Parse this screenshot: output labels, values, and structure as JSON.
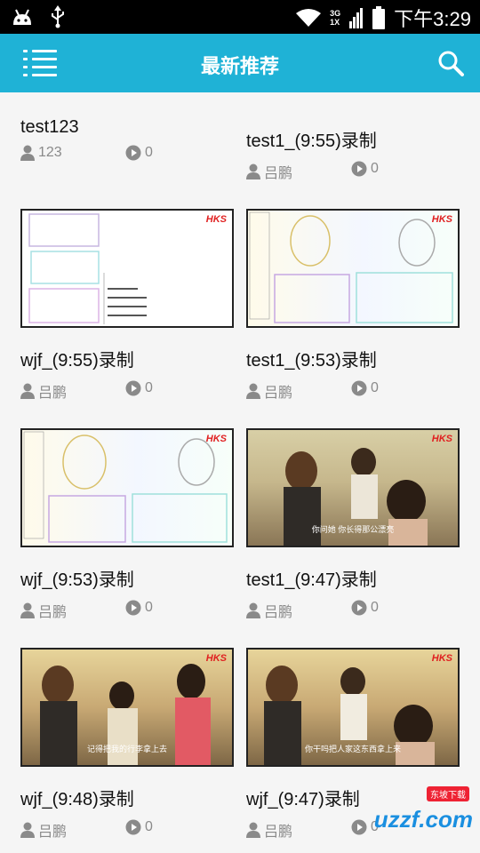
{
  "status_bar": {
    "net_top": "3G",
    "net_bottom": "1X",
    "time": "下午3:29"
  },
  "header": {
    "title": "最新推荐"
  },
  "videos": [
    {
      "title": "test123",
      "author": "123",
      "plays": "0"
    },
    {
      "title": "test1_(9:55)录制",
      "author": "吕鹏",
      "plays": "0"
    },
    {
      "title": "wjf_(9:55)录制",
      "author": "吕鹏",
      "plays": "0",
      "thumb_brand": "HKS"
    },
    {
      "title": "test1_(9:53)录制",
      "author": "吕鹏",
      "plays": "0",
      "thumb_brand": "HKS"
    },
    {
      "title": "wjf_(9:53)录制",
      "author": "吕鹏",
      "plays": "0",
      "thumb_brand": "HKS"
    },
    {
      "title": "test1_(9:47)录制",
      "author": "吕鹏",
      "plays": "0",
      "thumb_brand": "HKS"
    },
    {
      "title": "wjf_(9:48)录制",
      "author": "吕鹏",
      "plays": "0",
      "thumb_brand": "HKS"
    },
    {
      "title": "wjf_(9:47)录制",
      "author": "吕鹏",
      "plays": "0",
      "thumb_brand": "HKS"
    }
  ],
  "thumb_subtitles": {
    "test1_947": "你问她 你长得那公漂亮",
    "wjf_948": "记得把我的行李拿上去",
    "wjf_947": "你干吗把人家这东西拿上来"
  },
  "watermark": {
    "text": "uzzf.com",
    "badge": "东坡下载"
  },
  "colors": {
    "app_bar": "#1fb2d6",
    "status_bar": "#000000",
    "background": "#f5f5f5",
    "meta_text": "#8a8a8a"
  },
  "icons": [
    "android-icon",
    "usb-icon",
    "wifi-icon",
    "signal-icon",
    "battery-icon",
    "menu-icon",
    "search-icon",
    "user-icon",
    "play-count-icon"
  ]
}
